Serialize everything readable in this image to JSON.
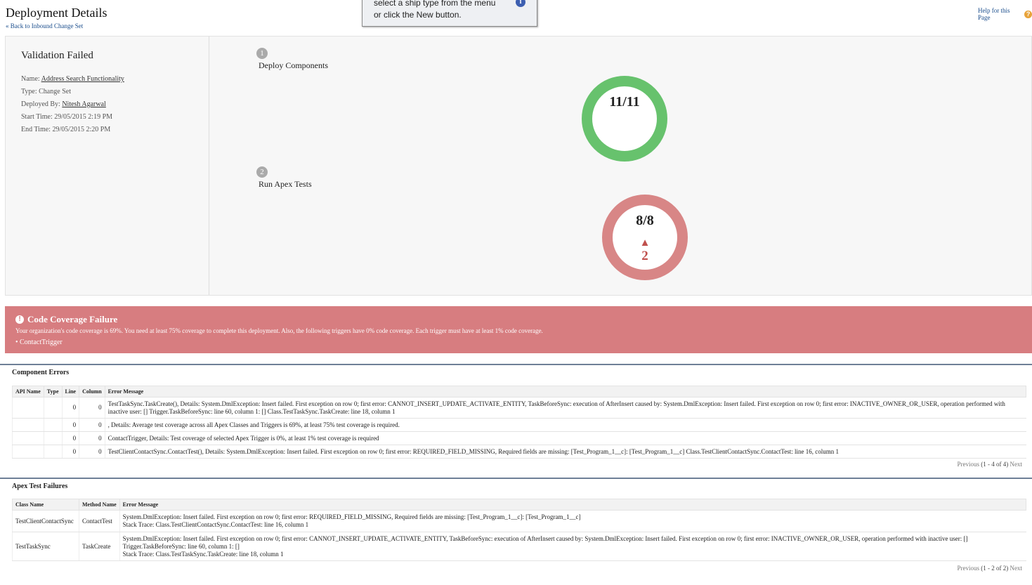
{
  "header": {
    "title": "Deployment Details",
    "back_link": "« Back to Inbound Change Set",
    "help_link": "Help for this Page",
    "help_icon": "?"
  },
  "tooltip": {
    "line1": "select a ship type from the menu",
    "line2": "or click the New button.",
    "icon": "i"
  },
  "summary": {
    "status": "Validation Failed",
    "name_label": "Name:",
    "name_value": "Address Search Functionality",
    "type_label": "Type:",
    "type_value": "Change Set",
    "deployed_by_label": "Deployed By:",
    "deployed_by_value": "Nitesh Agarwal",
    "start_label": "Start Time:",
    "start_value": "29/05/2015 2:19 PM",
    "end_label": "End Time:",
    "end_value": "29/05/2015 2:20 PM"
  },
  "steps": [
    {
      "num": "1",
      "label": "Deploy Components",
      "count": "11/11",
      "color": "#67c26d"
    },
    {
      "num": "2",
      "label": "Run Apex Tests",
      "count": "8/8",
      "failures": "2",
      "color": "#d88686"
    }
  ],
  "coverage": {
    "title": "Code Coverage Failure",
    "message": "Your organization's code coverage is 69%. You need at least 75% coverage to complete this deployment. Also, the following triggers have 0% code coverage. Each trigger must have at least 1% code coverage.",
    "trigger": "ContactTrigger",
    "bg_color": "#d77d80"
  },
  "component_errors": {
    "heading": "Component Errors",
    "columns": [
      "API Name",
      "Type",
      "Line",
      "Column",
      "Error Message"
    ],
    "rows": [
      {
        "api": "",
        "type": "",
        "line": "0",
        "column": "0",
        "msg": "TestTaskSync.TaskCreate(), Details: System.DmlException: Insert failed. First exception on row 0; first error: CANNOT_INSERT_UPDATE_ACTIVATE_ENTITY, TaskBeforeSync: execution of AfterInsert caused by: System.DmlException: Insert failed. First exception on row 0; first error: INACTIVE_OWNER_OR_USER, operation performed with inactive user: [] Trigger.TaskBeforeSync: line 60, column 1: [] Class.TestTaskSync.TaskCreate: line 18, column 1"
      },
      {
        "api": "",
        "type": "",
        "line": "0",
        "column": "0",
        "msg": ", Details: Average test coverage across all Apex Classes and Triggers is 69%, at least 75% test coverage is required."
      },
      {
        "api": "",
        "type": "",
        "line": "0",
        "column": "0",
        "msg": "ContactTrigger, Details: Test coverage of selected Apex Trigger is 0%, at least 1% test coverage is required"
      },
      {
        "api": "",
        "type": "",
        "line": "0",
        "column": "0",
        "msg": "TestClientContactSync.ContactTest(), Details: System.DmlException: Insert failed. First exception on row 0; first error: REQUIRED_FIELD_MISSING, Required fields are missing: [Test_Program_1__c]: [Test_Program_1__c] Class.TestClientContactSync.ContactTest: line 16, column 1"
      }
    ],
    "pager_prev": "Previous",
    "pager_range": "(1 - 4 of 4)",
    "pager_next": "Next"
  },
  "apex_failures": {
    "heading": "Apex Test Failures",
    "columns": [
      "Class Name",
      "Method Name",
      "Error Message"
    ],
    "rows": [
      {
        "class": "TestClientContactSync",
        "method": "ContactTest",
        "msg1": "System.DmlException: Insert failed. First exception on row 0; first error: REQUIRED_FIELD_MISSING, Required fields are missing: [Test_Program_1__c]: [Test_Program_1__c]",
        "msg2": "Stack Trace: Class.TestClientContactSync.ContactTest: line 16, column 1"
      },
      {
        "class": "TestTaskSync",
        "method": "TaskCreate",
        "msg1": "System.DmlException: Insert failed. First exception on row 0; first error: CANNOT_INSERT_UPDATE_ACTIVATE_ENTITY, TaskBeforeSync: execution of AfterInsert caused by: System.DmlException: Insert failed. First exception on row 0; first error: INACTIVE_OWNER_OR_USER, operation performed with inactive user: [] Trigger.TaskBeforeSync: line 60, column 1: []",
        "msg2": "Stack Trace: Class.TestTaskSync.TaskCreate: line 18, column 1"
      }
    ],
    "pager_prev": "Previous",
    "pager_range": "(1 - 2 of 2)",
    "pager_next": "Next"
  }
}
